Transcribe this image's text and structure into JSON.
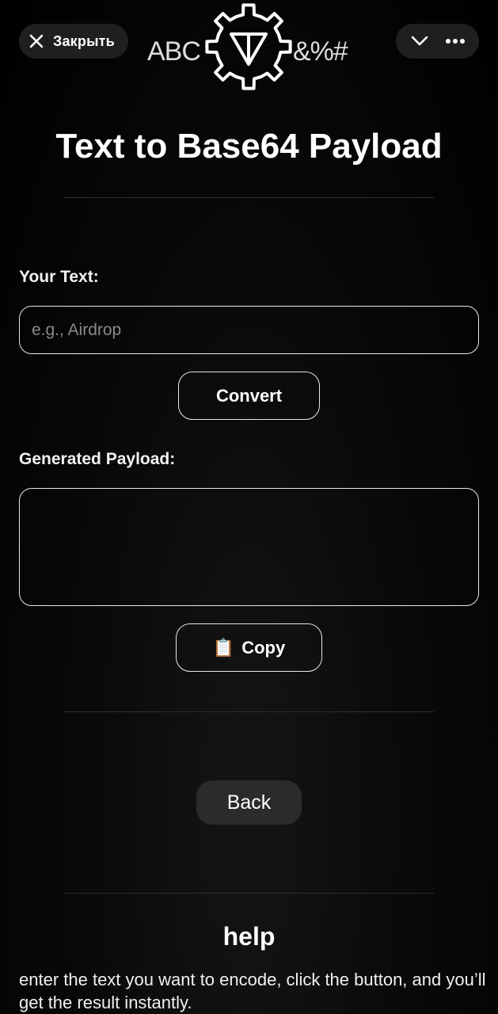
{
  "topbar": {
    "close_label": "Закрыть",
    "close_icon": "close-icon",
    "chevron_icon": "chevron-down-icon",
    "more_icon": "more-horizontal-icon"
  },
  "logo": {
    "left_text": "ABC",
    "right_text": "&%#"
  },
  "page": {
    "title": "Text to Base64 Payload"
  },
  "input": {
    "label": "Your Text:",
    "placeholder": "e.g., Airdrop",
    "value": ""
  },
  "convert": {
    "label": "Convert"
  },
  "output": {
    "label": "Generated Payload:",
    "value": ""
  },
  "copy": {
    "icon": "📋",
    "label": "Copy"
  },
  "back": {
    "label": "Back"
  },
  "help": {
    "title": "help",
    "text": "enter the text you want to encode, click the button, and you’ll get the result instantly."
  },
  "colors": {
    "background": "#000000",
    "pill": "#1f1f1f",
    "border": "#e8e8e8",
    "back_button": "#2b2b2b",
    "placeholder": "#8a8a8a"
  }
}
